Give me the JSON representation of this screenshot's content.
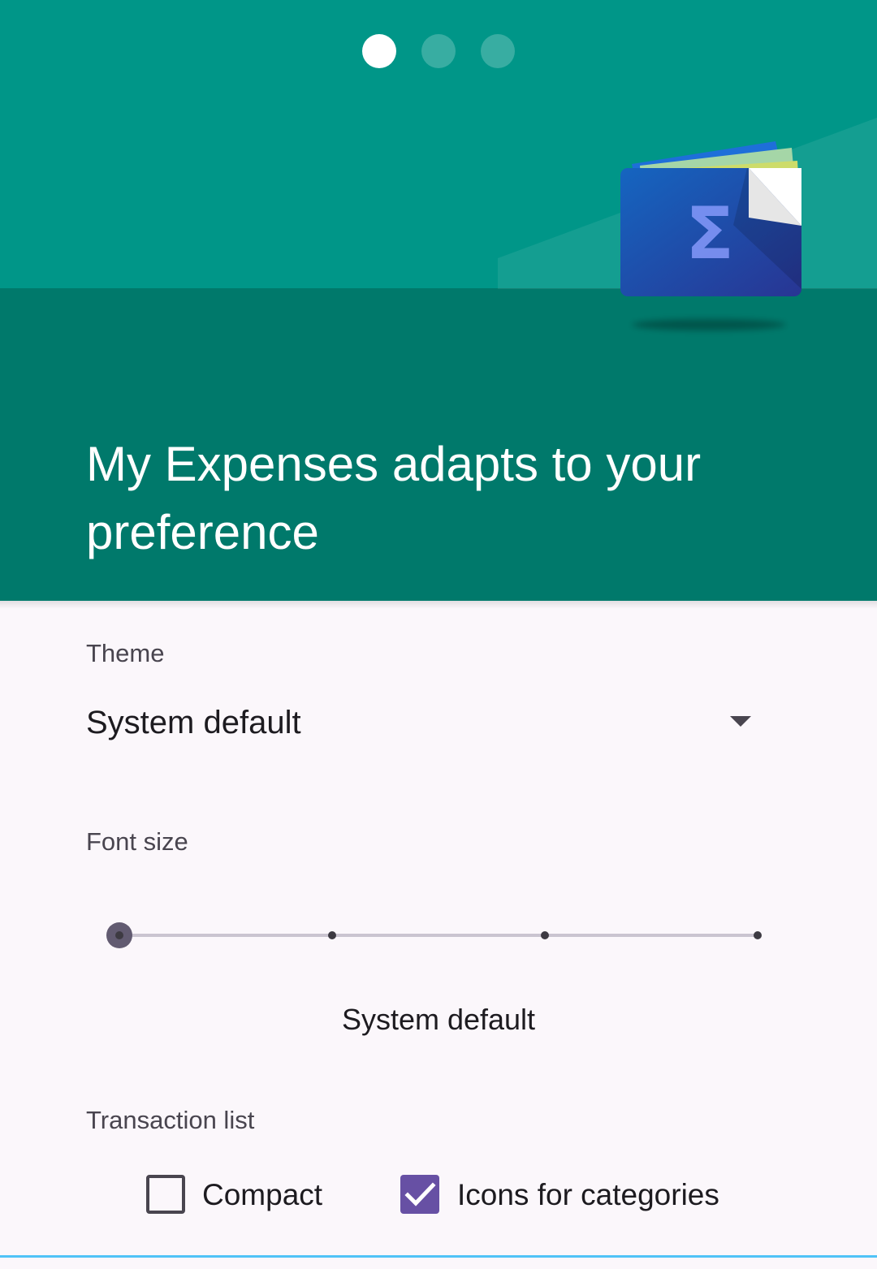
{
  "pager": {
    "total": 3,
    "active_index": 0,
    "active_color": "#ffffff"
  },
  "header": {
    "title": "My Expenses adapts to your preference",
    "colors": {
      "top": "#009688",
      "bottom": "#00796b",
      "text": "#ffffff"
    },
    "illustration_icon": "wallet-sigma-icon"
  },
  "theme": {
    "label": "Theme",
    "value": "System default"
  },
  "font_size": {
    "label": "Font size",
    "value": "System default",
    "steps": 4,
    "selected_step": 0
  },
  "transaction_list": {
    "label": "Transaction list",
    "compact": {
      "label": "Compact",
      "checked": false
    },
    "icons_for_categories": {
      "label": "Icons for categories",
      "checked": true
    }
  },
  "colors": {
    "accent": "#6750a4",
    "background": "#fbf7fb",
    "bottom_indicator": "#4fc3f7"
  }
}
